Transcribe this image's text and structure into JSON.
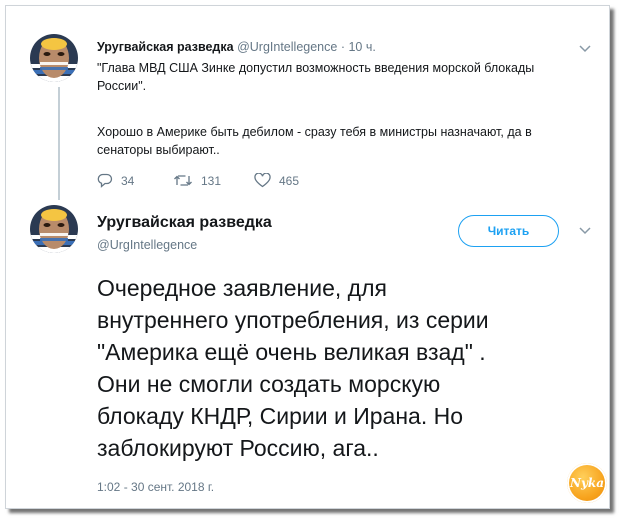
{
  "tweet1": {
    "author_name": "Уругвайская разведка",
    "author_handle": "@UrgIntellegence",
    "separator": "·",
    "time": "10 ч.",
    "text_line1": "\"Глава МВД США Зинке допустил возможность введения морской блокады",
    "text_line2": "России\".",
    "text_line3": "Хорошо в Америке быть дебилом - сразу тебя в министры назначают, да в",
    "text_line4": "сенаторы выбирают..",
    "reply_count": "34",
    "retweet_count": "131",
    "like_count": "465"
  },
  "tweet2": {
    "author_name": "Уругвайская разведка",
    "author_handle": "@UrgIntellegence",
    "follow_label": "Читать",
    "text_lines": [
      "Очередное заявление, для",
      "внутреннего употребления, из серии",
      "\"Америка ещё очень великая взад\" .",
      "Они не смогли создать морскую",
      "блокаду КНДР, Сирии и Ирана. Но",
      "заблокируют Россию, ага.."
    ],
    "timestamp": "1:02 - 30 сент. 2018 г."
  },
  "watermark": {
    "text": "Nyka"
  },
  "colors": {
    "accent": "#1da1f2",
    "muted": "#657786",
    "text": "#14171a",
    "thread_line": "#c4cfd6"
  }
}
